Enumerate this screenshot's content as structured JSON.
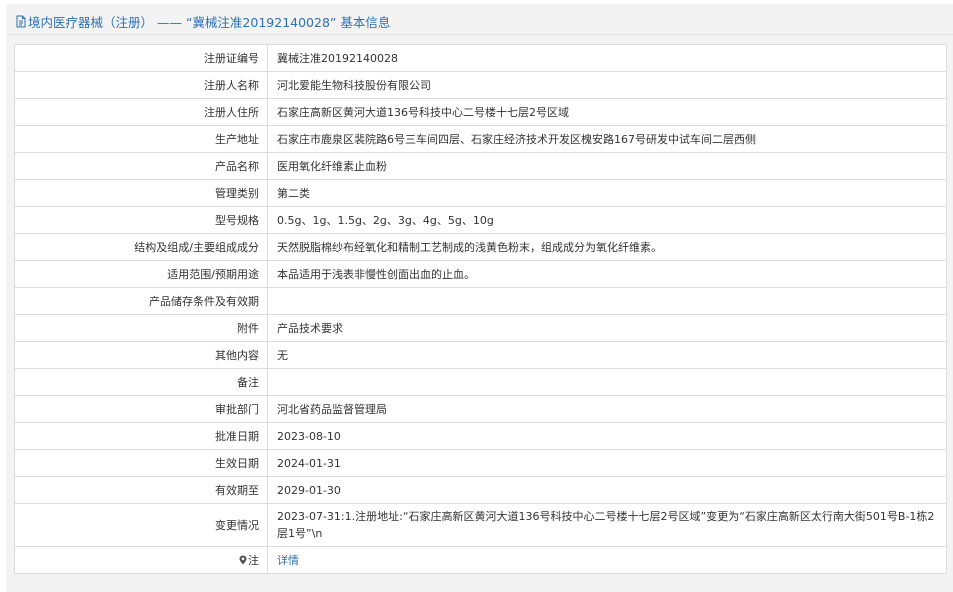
{
  "header": {
    "title": "境内医疗器械（注册） —— “冀械注准20192140028” 基本信息",
    "accent_color": "#2f6fb3"
  },
  "rows": [
    {
      "label": "注册证编号",
      "value": "冀械注准20192140028"
    },
    {
      "label": "注册人名称",
      "value": "河北爱能生物科技股份有限公司"
    },
    {
      "label": "注册人住所",
      "value": "石家庄高新区黄河大道136号科技中心二号楼十七层2号区域"
    },
    {
      "label": "生产地址",
      "value": "石家庄市鹿泉区裴院路6号三车间四层、石家庄经济技术开发区槐安路167号研发中试车间二层西侧"
    },
    {
      "label": "产品名称",
      "value": "医用氧化纤维素止血粉"
    },
    {
      "label": "管理类别",
      "value": "第二类"
    },
    {
      "label": "型号规格",
      "value": "0.5g、1g、1.5g、2g、3g、4g、5g、10g"
    },
    {
      "label": "结构及组成/主要组成成分",
      "value": "天然脱脂棉纱布经氧化和精制工艺制成的浅黄色粉末，组成成分为氧化纤维素。"
    },
    {
      "label": "适用范围/预期用途",
      "value": "本品适用于浅表非慢性创面出血的止血。"
    },
    {
      "label": "产品储存条件及有效期",
      "value": ""
    },
    {
      "label": "附件",
      "value": "产品技术要求"
    },
    {
      "label": "其他内容",
      "value": "无"
    },
    {
      "label": "备注",
      "value": ""
    },
    {
      "label": "审批部门",
      "value": "河北省药品监督管理局"
    },
    {
      "label": "批准日期",
      "value": "2023-08-10"
    },
    {
      "label": "生效日期",
      "value": "2024-01-31"
    },
    {
      "label": "有效期至",
      "value": "2029-01-30"
    },
    {
      "label": "变更情况",
      "value": "2023-07-31:1.注册地址:“石家庄高新区黄河大道136号科技中心二号楼十七层2号区域”变更为“石家庄高新区太行南大街501号B-1栋2层1号”\\n"
    }
  ],
  "note_row": {
    "label": "注",
    "icon": "location-pin-icon",
    "link_text": "详情"
  }
}
